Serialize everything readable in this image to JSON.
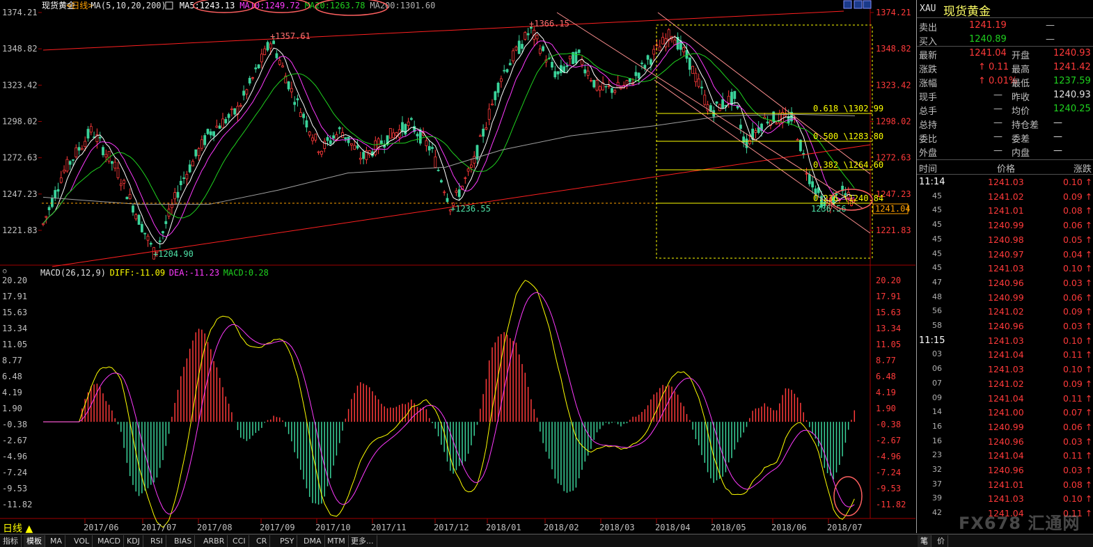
{
  "header": {
    "symbol": "现货黄金",
    "period": "<日线>",
    "ma_label": "MA(5,10,20,200)",
    "ma5": "MA5:1243.13",
    "ma10": "MA10:1249.72",
    "ma20": "MA20:1263.78",
    "ma200": "MA200:1301.60"
  },
  "price_axis": [
    "1374.21",
    "1348.82",
    "1323.42",
    "1298.02",
    "1272.63",
    "1247.23",
    "1221.83"
  ],
  "price_annotations": {
    "high1": "1357.61",
    "high2": "1366.15",
    "low1": "1204.90",
    "low2": "1236.55",
    "low3": "1236.56",
    "current_tag": "1241.04"
  },
  "fib_levels": [
    {
      "label": "0.618 \\1302.99"
    },
    {
      "label": "0.500 \\1283.80"
    },
    {
      "label": "0.382 \\1264.60"
    },
    {
      "label": "0.236 \\1240.84"
    }
  ],
  "macd": {
    "label": "MACD(26,12,9)",
    "diff": "DIFF:-11.09",
    "dea": "DEA:-11.23",
    "macd": "MACD:0.28",
    "axis": [
      "20.20",
      "17.91",
      "15.63",
      "13.34",
      "11.05",
      "8.77",
      "6.48",
      "4.19",
      "1.90",
      "-0.38",
      "-2.67",
      "-4.96",
      "-7.24",
      "-9.53",
      "-11.82"
    ]
  },
  "months": [
    "2017/06",
    "2017/07",
    "2017/08",
    "2017/09",
    "2017/10",
    "2017/11",
    "2017/12",
    "2018/01",
    "2018/02",
    "2018/03",
    "2018/04",
    "2018/05",
    "2018/06",
    "2018/07"
  ],
  "bottom_label": "日线 ▲",
  "tabs": [
    "指标",
    "模板",
    "MA",
    "VOL",
    "MACD",
    "KDJ",
    "RSI",
    "BIAS",
    "ARBR",
    "CCI",
    "CR",
    "PSY",
    "DMA",
    "MTM",
    "更多..."
  ],
  "side_tabs": [
    "笔",
    "价"
  ],
  "quote": {
    "code": "XAU",
    "name": "现货黄金",
    "sell_label": "卖出",
    "sell": "1241.19",
    "sell_vol": "—",
    "buy_label": "买入",
    "buy": "1240.89",
    "buy_vol": "—",
    "rows": [
      {
        "l1": "最新",
        "v1": "1241.04",
        "l2": "开盘",
        "v2": "1240.93"
      },
      {
        "l1": "涨跌",
        "v1": "0.11",
        "l2": "最高",
        "v2": "1241.42"
      },
      {
        "l1": "涨幅",
        "v1": "0.01%",
        "l2": "最低",
        "v2": "1237.59"
      },
      {
        "l1": "现手",
        "v1": "—",
        "l2": "昨收",
        "v2": "1240.93"
      },
      {
        "l1": "总手",
        "v1": "—",
        "l2": "均价",
        "v2": "1240.25"
      },
      {
        "l1": "总持",
        "v1": "—",
        "l2": "持仓差",
        "v2": "—"
      },
      {
        "l1": "委比",
        "v1": "—",
        "l2": "委差",
        "v2": "—"
      },
      {
        "l1": "外盘",
        "v1": "—",
        "l2": "内盘",
        "v2": "—"
      }
    ]
  },
  "ticks_header": {
    "time": "时间",
    "price": "价格",
    "change": "涨跌"
  },
  "ticks": [
    {
      "t": "11:14",
      "p": "1241.03",
      "c": "0.10"
    },
    {
      "t": "45",
      "p": "1241.02",
      "c": "0.09"
    },
    {
      "t": "45",
      "p": "1241.01",
      "c": "0.08"
    },
    {
      "t": "45",
      "p": "1240.99",
      "c": "0.06"
    },
    {
      "t": "45",
      "p": "1240.98",
      "c": "0.05"
    },
    {
      "t": "45",
      "p": "1240.97",
      "c": "0.04"
    },
    {
      "t": "45",
      "p": "1241.03",
      "c": "0.10"
    },
    {
      "t": "47",
      "p": "1240.96",
      "c": "0.03"
    },
    {
      "t": "48",
      "p": "1240.99",
      "c": "0.06"
    },
    {
      "t": "56",
      "p": "1241.02",
      "c": "0.09"
    },
    {
      "t": "58",
      "p": "1240.96",
      "c": "0.03"
    },
    {
      "t": "11:15",
      "p": "1241.03",
      "c": "0.10"
    },
    {
      "t": "03",
      "p": "1241.04",
      "c": "0.11"
    },
    {
      "t": "06",
      "p": "1241.03",
      "c": "0.10"
    },
    {
      "t": "07",
      "p": "1241.02",
      "c": "0.09"
    },
    {
      "t": "09",
      "p": "1241.04",
      "c": "0.11"
    },
    {
      "t": "14",
      "p": "1241.00",
      "c": "0.07"
    },
    {
      "t": "16",
      "p": "1240.99",
      "c": "0.06"
    },
    {
      "t": "16",
      "p": "1240.96",
      "c": "0.03"
    },
    {
      "t": "23",
      "p": "1241.04",
      "c": "0.11"
    },
    {
      "t": "32",
      "p": "1240.96",
      "c": "0.03"
    },
    {
      "t": "37",
      "p": "1241.01",
      "c": "0.08"
    },
    {
      "t": "39",
      "p": "1241.03",
      "c": "0.10"
    },
    {
      "t": "42",
      "p": "1241.04",
      "c": "0.11"
    }
  ],
  "watermark": "FX678 汇通网",
  "colors": {
    "up": "#ff3a3a",
    "down": "#3ad39a",
    "ma5": "#ffffff",
    "ma10": "#ff3aff",
    "ma20": "#1fd21f",
    "ma200": "#a0a0a0",
    "fib": "#ffff00",
    "trend": "#ff2020",
    "channel": "#ff9090"
  }
}
